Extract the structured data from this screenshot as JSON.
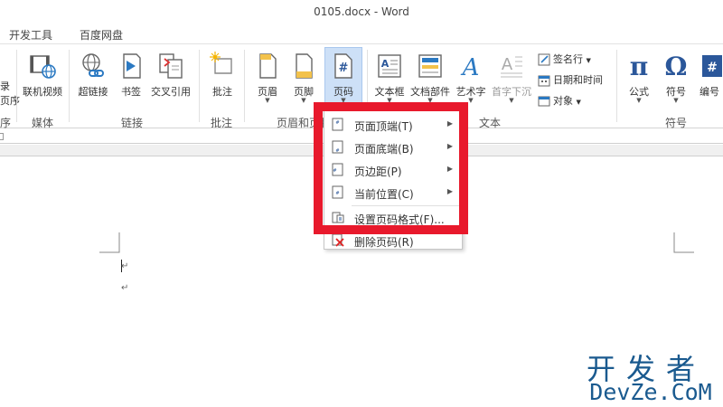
{
  "window": {
    "title": "0105.docx - Word"
  },
  "tabs": [
    "开发工具",
    "百度网盘"
  ],
  "ribbon": {
    "left_partial": {
      "label1": "录",
      "label2": "页序",
      "label3": "序"
    },
    "buttons": {
      "online_video": "联机视频",
      "hyperlink": "超链接",
      "bookmark": "书签",
      "cross_reference": "交叉引用",
      "comment": "批注",
      "header": "页眉",
      "footer": "页脚",
      "page_number": "页码",
      "text_box": "文本框",
      "quick_parts": "文档部件",
      "wordart": "艺术字",
      "drop_cap": "首字下沉",
      "equation": "公式",
      "symbol": "符号",
      "numbering": "编号"
    },
    "small_buttons": {
      "signature_line": "签名行",
      "date_time": "日期和时间",
      "object": "对象"
    },
    "groups": {
      "media": "媒体",
      "links": "链接",
      "comments": "批注",
      "header_footer": "页眉和页脚",
      "text": "文本",
      "symbols": "符号"
    }
  },
  "menu": {
    "items": [
      {
        "label": "页面顶端(T)",
        "submenu": "▶"
      },
      {
        "label": "页面底端(B)",
        "submenu": "▶"
      },
      {
        "label": "页边距(P)",
        "submenu": "▶"
      },
      {
        "label": "当前位置(C)",
        "submenu": "▶"
      },
      {
        "label": "设置页码格式(F)...",
        "submenu": ""
      },
      {
        "label": "删除页码(R)",
        "submenu": ""
      }
    ]
  },
  "document": {
    "para_mark_1": "↵",
    "para_mark_2": "↵"
  },
  "watermark": {
    "line1": "开发者",
    "line2": "DevZe.CoM"
  },
  "colors": {
    "highlight": "#e8192c",
    "accent": "#2b579a",
    "active_bg": "#cde0f7",
    "watermark": "#1a5a8f"
  }
}
